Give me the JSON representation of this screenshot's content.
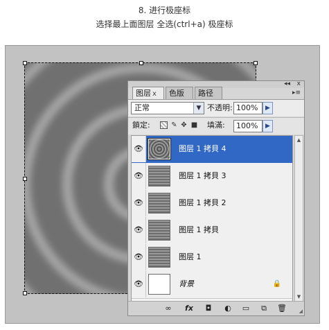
{
  "captions": {
    "step": "8. 进行极座标",
    "instruction": "选择最上面图层 全选(ctrl+a) 极座标"
  },
  "panel": {
    "top_controls": {
      "collapse": "◂◂",
      "close": "x"
    },
    "tabs": [
      {
        "label": "图层",
        "close": "x",
        "active": true
      },
      {
        "label": "色版",
        "active": false
      },
      {
        "label": "路径",
        "active": false
      }
    ],
    "menu_icon": "▸≡",
    "blend_mode": "正常",
    "opacity_label": "不透明:",
    "opacity_value": "100%",
    "lock_label": "鎖定:",
    "lock_icons": [
      "transparency-lock-icon",
      "brush-lock-icon",
      "move-lock-icon",
      "padlock-icon"
    ],
    "fill_label": "填滿:",
    "fill_value": "100%",
    "layers": [
      {
        "name": "图层 1 拷貝 4",
        "selected": true,
        "thumb": "circles"
      },
      {
        "name": "图层 1 拷貝 3",
        "selected": false,
        "thumb": "stripes"
      },
      {
        "name": "图层 1 拷貝 2",
        "selected": false,
        "thumb": "stripes"
      },
      {
        "name": "图层 1 拷貝",
        "selected": false,
        "thumb": "stripes"
      },
      {
        "name": "图层 1",
        "selected": false,
        "thumb": "stripes"
      },
      {
        "name": "背景",
        "selected": false,
        "thumb": "white",
        "italic": true,
        "locked": true
      }
    ],
    "footer_icons": [
      "link-layers-icon",
      "fx-icon",
      "mask-icon",
      "adjustment-icon",
      "group-icon",
      "new-layer-icon",
      "trash-icon"
    ],
    "footer_labels": {
      "link": "∞",
      "fx": "fx",
      "mask": "◘",
      "adjust": "◐",
      "group": "▭",
      "new": "⧉",
      "trash": "🗑"
    }
  },
  "colors": {
    "selection": "#3168c6",
    "canvas": "#6f6f6f",
    "workspace": "#c2c2c2"
  }
}
